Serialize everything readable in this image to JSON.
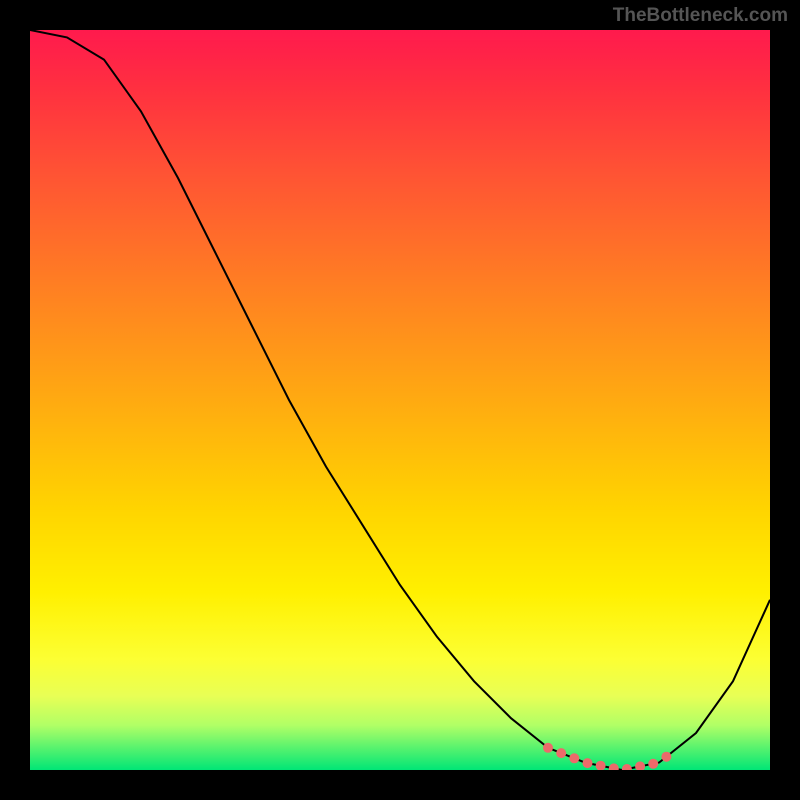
{
  "watermark": "TheBottleneck.com",
  "chart_data": {
    "type": "line",
    "title": "",
    "xlabel": "",
    "ylabel": "",
    "x": [
      0.0,
      0.05,
      0.1,
      0.15,
      0.2,
      0.25,
      0.3,
      0.35,
      0.4,
      0.45,
      0.5,
      0.55,
      0.6,
      0.65,
      0.7,
      0.75,
      0.8,
      0.85,
      0.9,
      0.95,
      1.0
    ],
    "values": [
      1.0,
      0.99,
      0.96,
      0.89,
      0.8,
      0.7,
      0.6,
      0.5,
      0.41,
      0.33,
      0.25,
      0.18,
      0.12,
      0.07,
      0.03,
      0.01,
      0.0,
      0.01,
      0.05,
      0.12,
      0.23
    ],
    "xlim": [
      0,
      1
    ],
    "ylim": [
      0,
      1
    ],
    "trough": {
      "x_start": 0.7,
      "x_end": 0.86,
      "marker_color": "#ec6a6a",
      "markers": 10
    },
    "background": "rainbow-vertical-gradient",
    "curve_color": "#000000",
    "frame_color": "#000000"
  }
}
